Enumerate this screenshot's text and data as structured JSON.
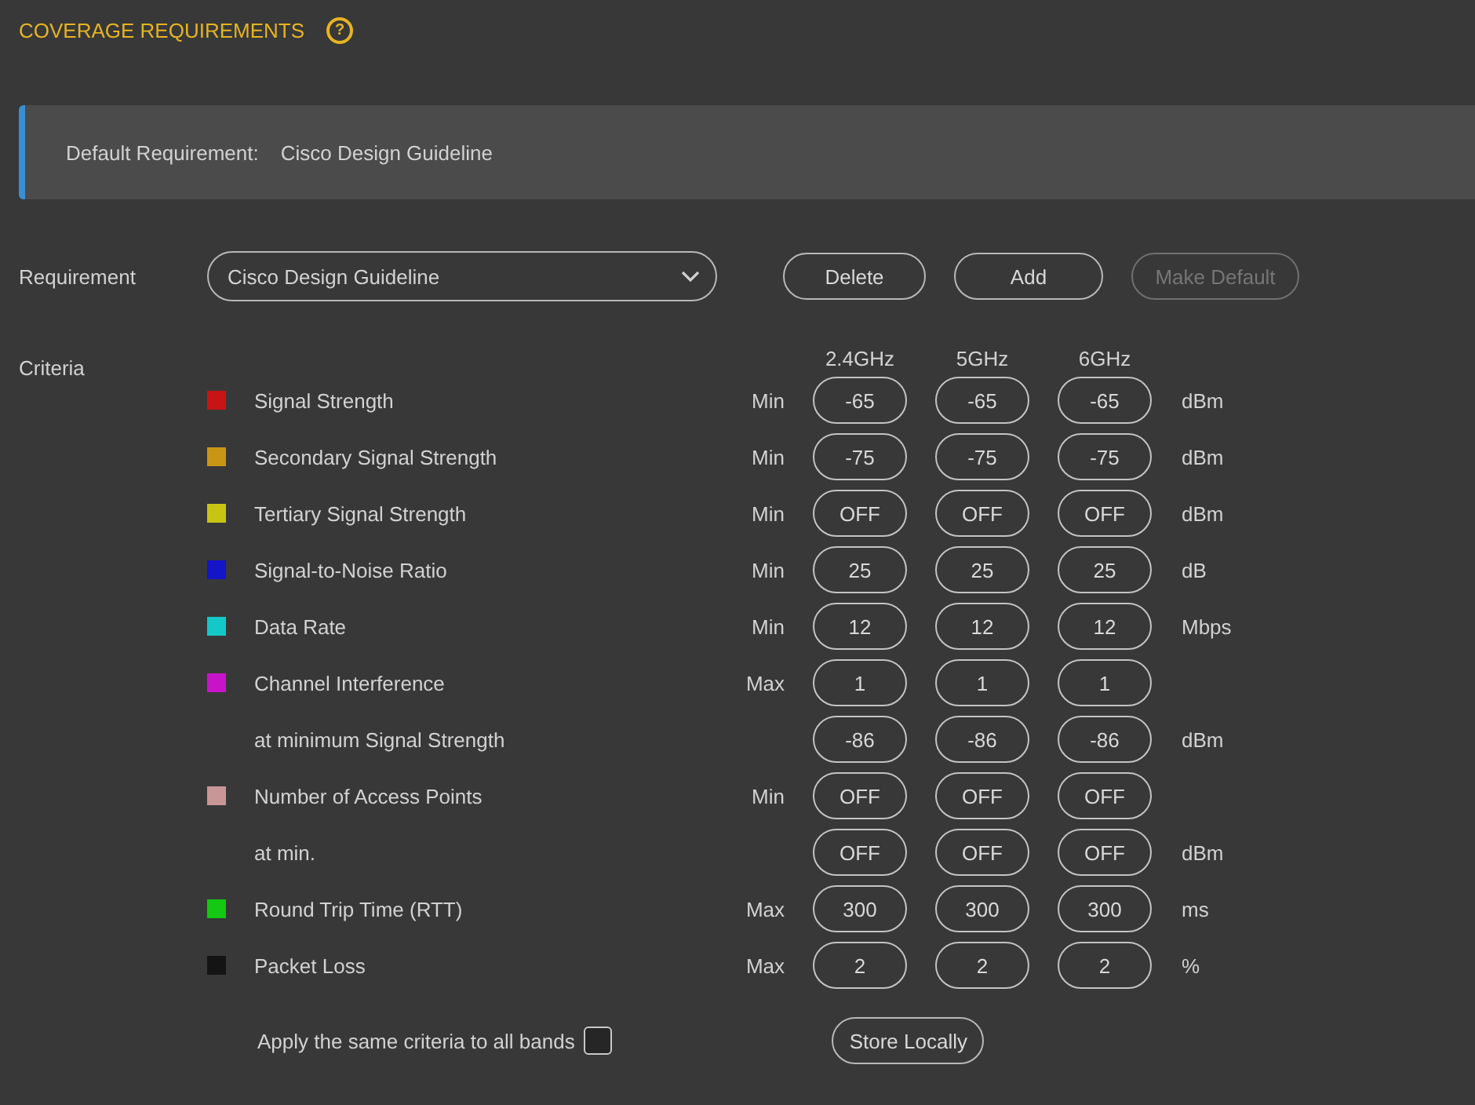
{
  "header": {
    "title": "COVERAGE REQUIREMENTS",
    "help": "?"
  },
  "banner": {
    "label": "Default Requirement:",
    "value": "Cisco Design Guideline"
  },
  "requirement": {
    "label": "Requirement",
    "value": "Cisco Design Guideline",
    "buttons": [
      {
        "label": "Delete",
        "disabled": false
      },
      {
        "label": "Add",
        "disabled": false
      },
      {
        "label": "Make Default",
        "disabled": true
      }
    ]
  },
  "criteria": {
    "label": "Criteria",
    "bands": [
      "2.4GHz",
      "5GHz",
      "6GHz"
    ],
    "rows": [
      {
        "kind": "main",
        "color": "#c81414",
        "name": "Signal Strength",
        "modifier": "Min",
        "values": [
          "-65",
          "-65",
          "-65"
        ],
        "unit": "dBm"
      },
      {
        "kind": "main",
        "color": "#c89614",
        "name": "Secondary Signal Strength",
        "modifier": "Min",
        "values": [
          "-75",
          "-75",
          "-75"
        ],
        "unit": "dBm"
      },
      {
        "kind": "main",
        "color": "#c8c414",
        "name": "Tertiary Signal Strength",
        "modifier": "Min",
        "values": [
          "OFF",
          "OFF",
          "OFF"
        ],
        "unit": "dBm"
      },
      {
        "kind": "main",
        "color": "#1414c8",
        "name": "Signal-to-Noise Ratio",
        "modifier": "Min",
        "values": [
          "25",
          "25",
          "25"
        ],
        "unit": "dB"
      },
      {
        "kind": "main",
        "color": "#14c8c8",
        "name": "Data Rate",
        "modifier": "Min",
        "values": [
          "12",
          "12",
          "12"
        ],
        "unit": "Mbps"
      },
      {
        "kind": "main",
        "color": "#c814c8",
        "name": "Channel Interference",
        "modifier": "Max",
        "values": [
          "1",
          "1",
          "1"
        ]
      },
      {
        "kind": "sub",
        "name": "at minimum Signal Strength",
        "values": [
          "-86",
          "-86",
          "-86"
        ],
        "unit": "dBm"
      },
      {
        "kind": "main",
        "color": "#c89696",
        "name": "Number of Access Points",
        "modifier": "Min",
        "values": [
          "OFF",
          "OFF",
          "OFF"
        ]
      },
      {
        "kind": "sub",
        "name": "at min.",
        "values": [
          "OFF",
          "OFF",
          "OFF"
        ],
        "unit": "dBm"
      },
      {
        "kind": "main",
        "color": "#14c814",
        "name": "Round Trip Time (RTT)",
        "modifier": "Max",
        "values": [
          "300",
          "300",
          "300"
        ],
        "unit": "ms"
      },
      {
        "kind": "main",
        "color": "#141414",
        "name": "Packet Loss",
        "modifier": "Max",
        "values": [
          "2",
          "2",
          "2"
        ],
        "unit": "%"
      }
    ]
  },
  "apply_all": {
    "label": "Apply the same criteria to all bands",
    "checked": false
  },
  "store_button": "Store Locally"
}
